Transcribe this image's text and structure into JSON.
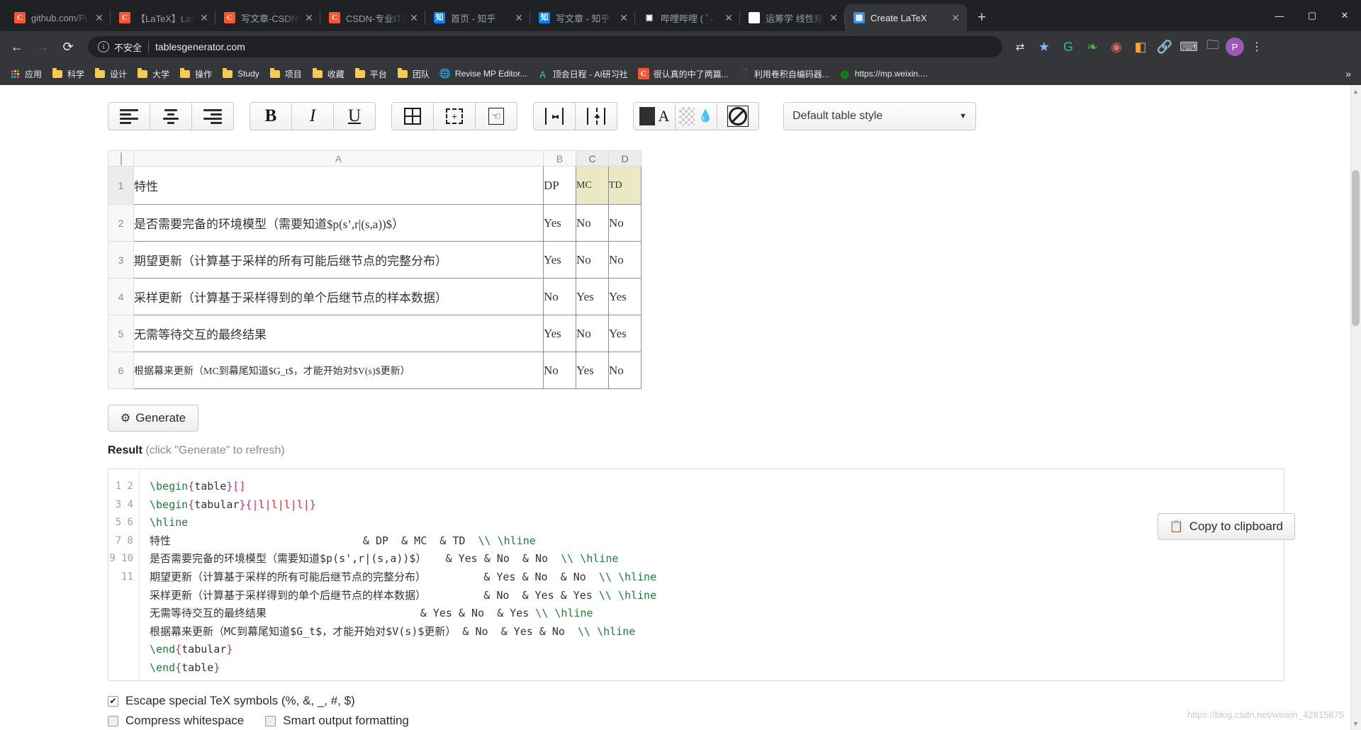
{
  "browser": {
    "tabs": [
      {
        "favicon": "csdn-icon",
        "title": "github.com/Pi",
        "active": false
      },
      {
        "favicon": "csdn-icon",
        "title": "【LaTeX】LaTe",
        "active": false
      },
      {
        "favicon": "csdn-icon",
        "title": "写文章-CSDN博",
        "active": false
      },
      {
        "favicon": "csdn-icon",
        "title": "CSDN-专业IT技",
        "active": false
      },
      {
        "favicon": "zhihu-icon",
        "title": "首页 - 知乎",
        "active": false
      },
      {
        "favicon": "zhihu-icon",
        "title": "写文章 - 知乎",
        "active": false
      },
      {
        "favicon": "bilibili-icon",
        "title": "哔哩哔哩 ( ﾟ-",
        "active": false
      },
      {
        "favicon": "baidu-icon",
        "title": "运筹学 线性规划",
        "active": false
      },
      {
        "favicon": "tablesgenerator-icon",
        "title": "Create LaTeX",
        "active": true
      }
    ],
    "new_tab_label": "+",
    "window_controls": {
      "minimize": "—",
      "maximize": "▢",
      "close": "✕"
    },
    "nav": {
      "back": "←",
      "forward": "→",
      "reload": "⟳",
      "security_icon": "info-icon",
      "security_text": "不安全",
      "url": "tablesgenerator.com"
    },
    "nav_right_icons": [
      "translate-icon",
      "bookmark-star-icon",
      "grammarly-icon",
      "leaf-icon",
      "eye-icon",
      "colorpicker-icon",
      "link-icon",
      "keyboard-icon",
      "folder-icon",
      "profile-avatar",
      "more-menu-icon"
    ],
    "profile_initial": "P",
    "bookmarks": [
      {
        "icon": "apps-grid-icon",
        "label": "应用"
      },
      {
        "icon": "folder-icon",
        "label": "科学"
      },
      {
        "icon": "folder-icon",
        "label": "设计"
      },
      {
        "icon": "folder-icon",
        "label": "大学"
      },
      {
        "icon": "folder-icon",
        "label": "操作"
      },
      {
        "icon": "folder-icon",
        "label": "Study"
      },
      {
        "icon": "folder-icon",
        "label": "项目"
      },
      {
        "icon": "folder-icon",
        "label": "收藏"
      },
      {
        "icon": "folder-icon",
        "label": "平台"
      },
      {
        "icon": "folder-icon",
        "label": "团队"
      },
      {
        "icon": "globe-icon",
        "label": "Revise MP Editor..."
      },
      {
        "icon": "ai-icon",
        "label": "顶会日程 - AI研习社"
      },
      {
        "icon": "csdn-icon",
        "label": "很认真的中了两篇..."
      },
      {
        "icon": "page-icon",
        "label": "利用卷积自编码器..."
      },
      {
        "icon": "wechat-icon",
        "label": "https://mp.weixin...."
      }
    ],
    "bookmarks_overflow": "»"
  },
  "toolbar": {
    "align_left": "align-left-icon",
    "align_center": "align-center-icon",
    "align_right": "align-right-icon",
    "bold": "B",
    "italic": "I",
    "underline": "U",
    "borders": "table-borders-icon",
    "dashed_borders": "table-inner-borders-icon",
    "select_cells": "cell-select-hand-icon",
    "merge_cells": "merge-cells-icon",
    "split_cells": "split-cells-icon",
    "text_color": "A",
    "fill_color": "fill-drop-icon",
    "clear_format": "clear-formatting-icon",
    "table_style": "Default table style",
    "table_style_caret": "▼"
  },
  "sheet": {
    "column_headers": [
      "",
      "A",
      "B",
      "C",
      "D"
    ],
    "selected_columns": [
      "C",
      "D"
    ],
    "row_numbers": [
      "1",
      "2",
      "3",
      "4",
      "5",
      "6"
    ],
    "rows": [
      {
        "a": "特性",
        "b": "DP",
        "c": "MC",
        "d": "TD",
        "highlight": true
      },
      {
        "a": "是否需要完备的环境模型（需要知道$p(s’,r|(s,a))$）",
        "b": "Yes",
        "c": "No",
        "d": "No",
        "highlight": false
      },
      {
        "a": "期望更新（计算基于采样的所有可能后继节点的完整分布）",
        "b": "Yes",
        "c": "No",
        "d": "No",
        "highlight": false
      },
      {
        "a": "采样更新（计算基于采样得到的单个后继节点的样本数据）",
        "b": "No",
        "c": "Yes",
        "d": "Yes",
        "highlight": false
      },
      {
        "a": "无需等待交互的最终结果",
        "b": "Yes",
        "c": "No",
        "d": "Yes",
        "highlight": false
      },
      {
        "a": "根据幕来更新（MC到幕尾知道$G_t$，才能开始对$V(s)$更新）",
        "b": "No",
        "c": "Yes",
        "d": "No",
        "highlight": false
      }
    ]
  },
  "actions": {
    "generate_label": "Generate",
    "generate_icon": "gears-icon",
    "copy_label": "Copy to clipboard",
    "copy_icon": "clipboard-icon",
    "result_label": "Result",
    "result_hint": "(click \"Generate\" to refresh)"
  },
  "code": {
    "line_numbers": [
      "1",
      "2",
      "3",
      "4",
      "5",
      "6",
      "7",
      "8",
      "9",
      "10",
      "11"
    ],
    "lines": [
      "\\begin{table}[]",
      "\\begin{tabular}{|l|l|l|l|}",
      "\\hline",
      "特性                              & DP  & MC  & TD  \\\\ \\hline",
      "是否需要完备的环境模型（需要知道$p(s',r|(s,a))$）   & Yes & No  & No  \\\\ \\hline",
      "期望更新（计算基于采样的所有可能后继节点的完整分布）         & Yes & No  & No  \\\\ \\hline",
      "采样更新（计算基于采样得到的单个后继节点的样本数据）         & No  & Yes & Yes \\\\ \\hline",
      "无需等待交互的最终结果                        & Yes & No  & Yes \\\\ \\hline",
      "根据幕来更新（MC到幕尾知道$G_t$，才能开始对$V(s)$更新） & No  & Yes & No  \\\\ \\hline",
      "\\end{tabular}",
      "\\end{table}"
    ]
  },
  "options": [
    {
      "label": "Escape special TeX symbols (%, &, _, #, $)",
      "checked": true
    },
    {
      "label": "Compress whitespace",
      "checked": false
    },
    {
      "label": "Smart output formatting",
      "checked": false
    }
  ],
  "watermark": "https://blog.csdn.net/weixin_42815875",
  "colors": {
    "chrome_bg": "#35363a",
    "tabstrip_bg": "#202124",
    "accent": "#3b8fe0",
    "highlight_cell": "#ebe8c4",
    "code_command": "#1a7f37",
    "code_brace": "#b5347a",
    "code_arg": "#cc3333"
  }
}
